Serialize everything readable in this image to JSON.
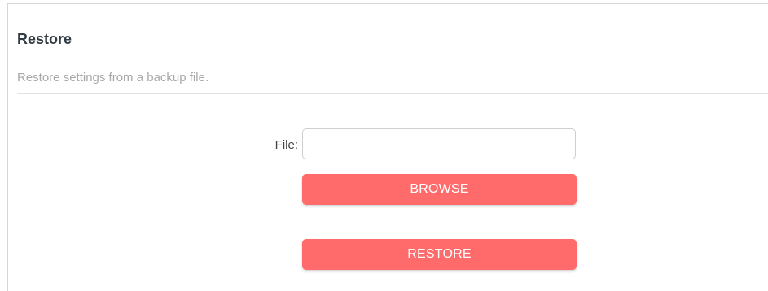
{
  "section": {
    "title": "Restore",
    "description": "Restore settings from a backup file."
  },
  "file_field": {
    "label": "File:",
    "value": "",
    "placeholder": ""
  },
  "buttons": {
    "browse_label": "BROWSE",
    "restore_label": "RESTORE"
  },
  "colors": {
    "accent": "#ff6b6b",
    "title_text": "#333c44",
    "description_text": "#a8a8a8"
  }
}
